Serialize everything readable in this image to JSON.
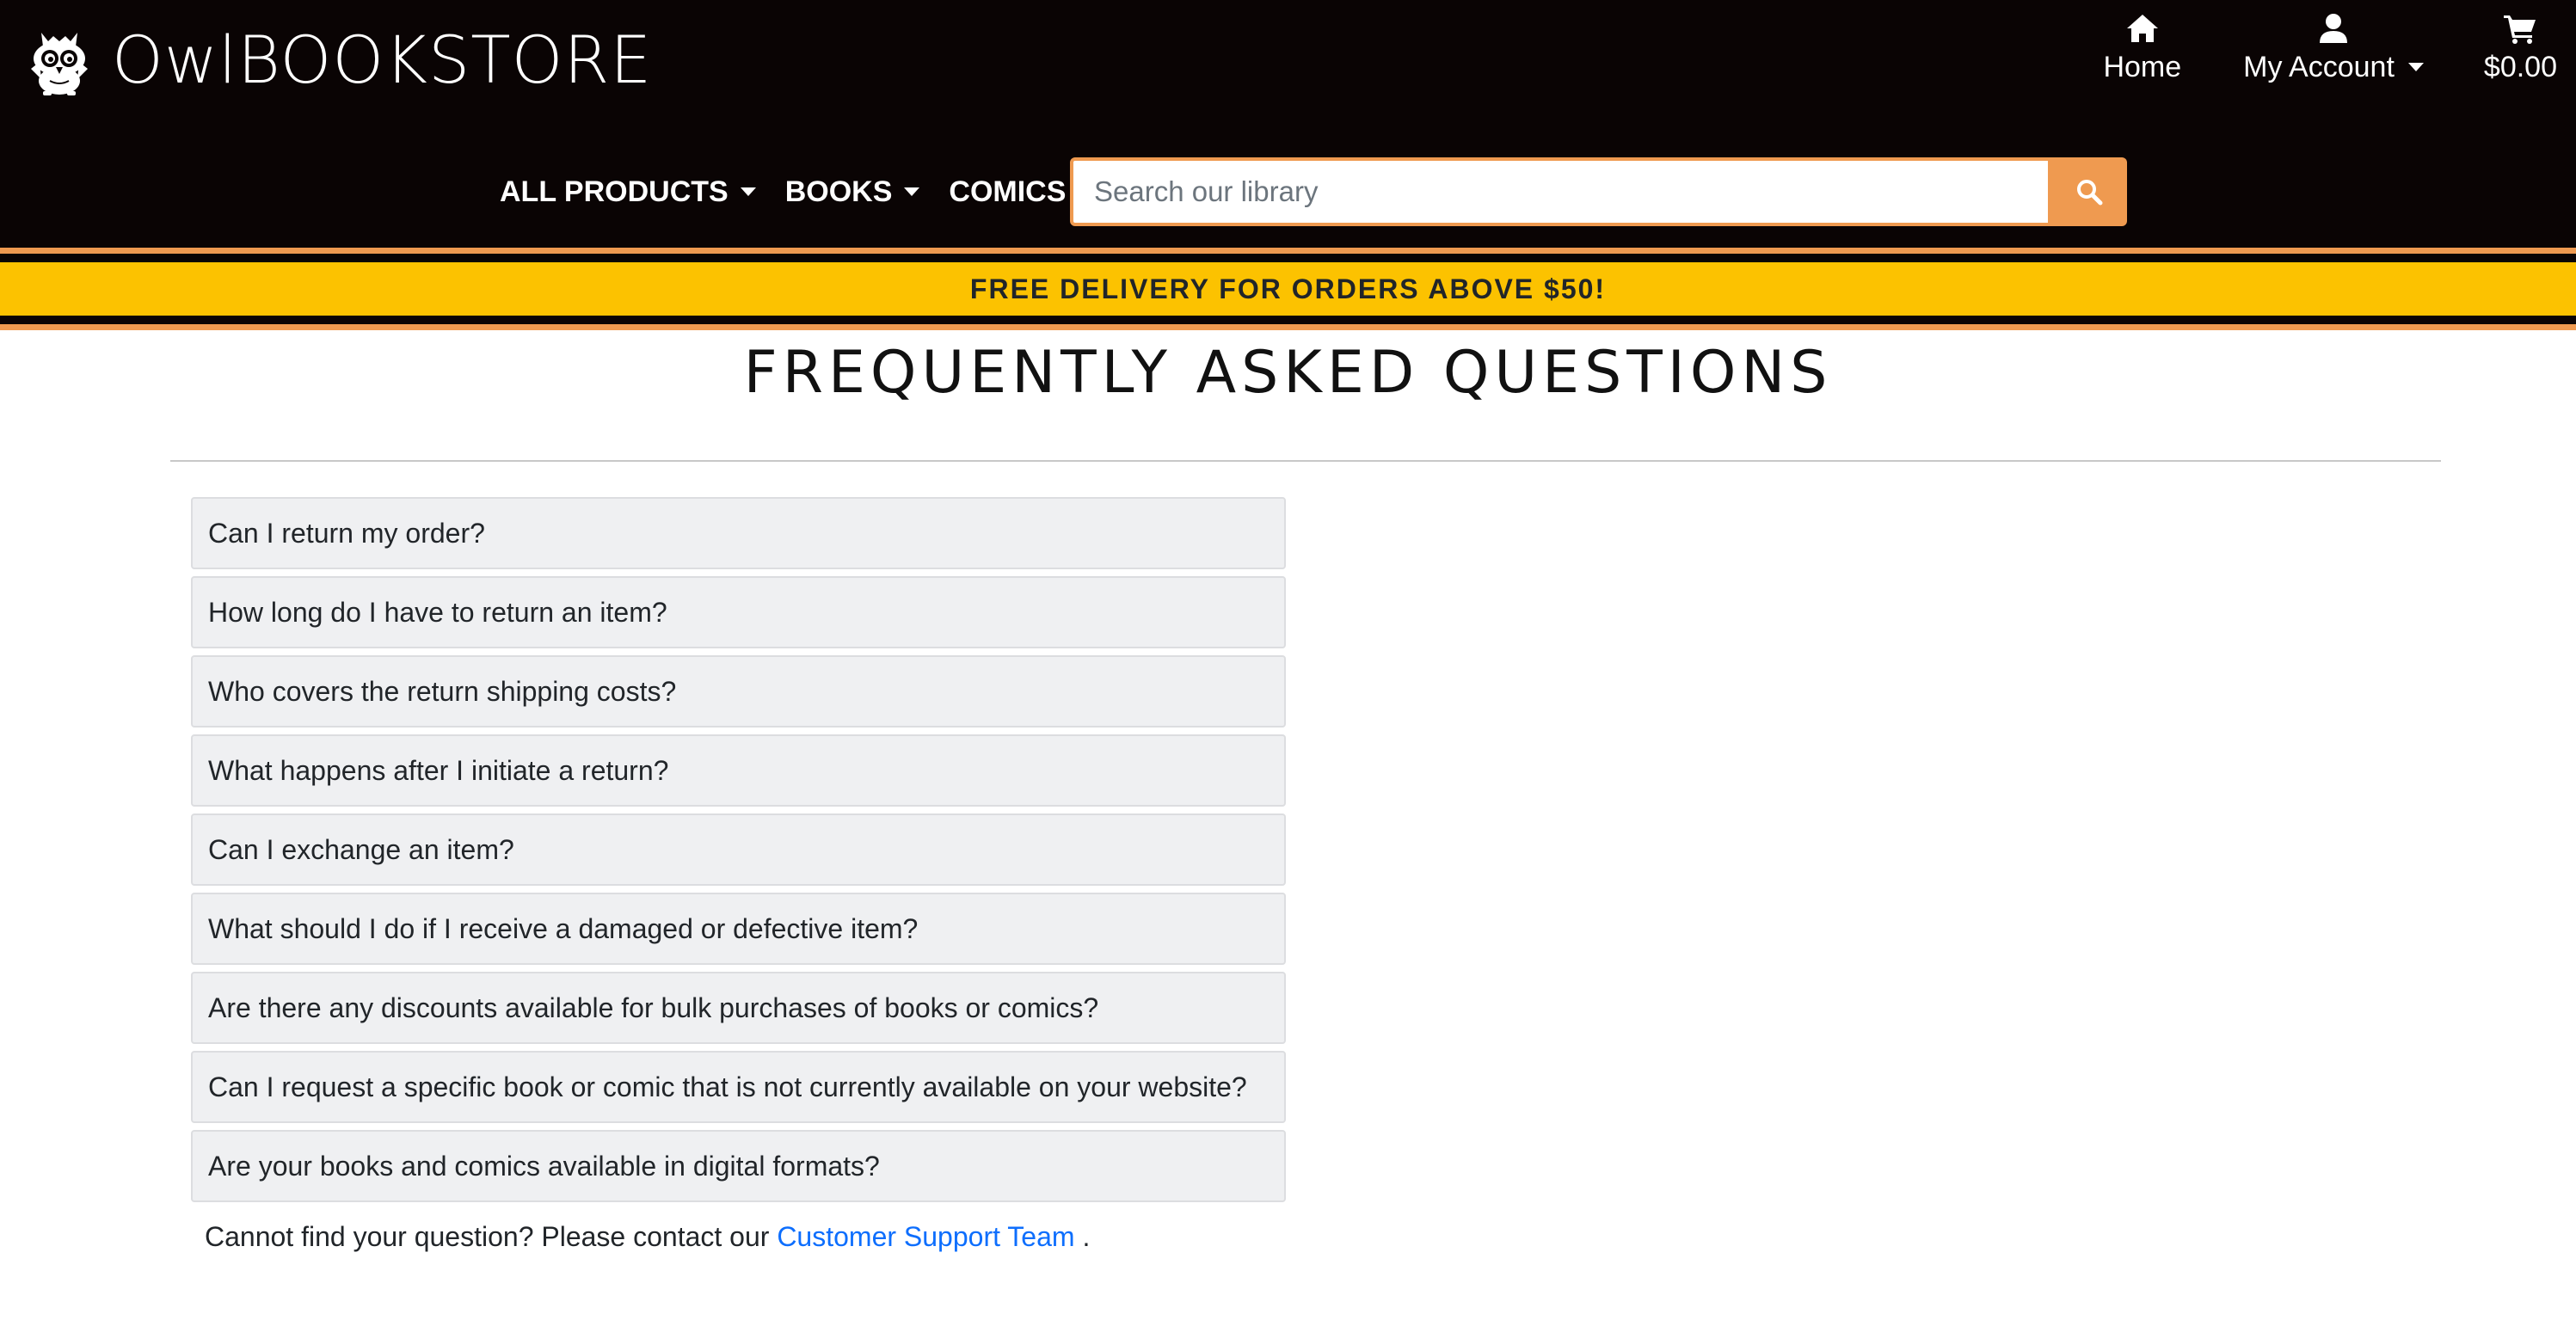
{
  "brand": {
    "name_light": "Owl",
    "name_bold": "BOOKSTORE",
    "logo_icon": "owl-icon"
  },
  "topnav": {
    "home": {
      "label": "Home",
      "icon": "home-icon"
    },
    "account": {
      "label": "My Account",
      "icon": "user-icon"
    },
    "cart": {
      "label": "$0.00",
      "icon": "cart-icon"
    }
  },
  "categories": [
    {
      "label": "ALL PRODUCTS"
    },
    {
      "label": "BOOKS"
    },
    {
      "label": "COMICS"
    }
  ],
  "search": {
    "placeholder": "Search our library",
    "value": "",
    "icon": "search-icon"
  },
  "banner": {
    "text": "FREE DELIVERY FOR ORDERS ABOVE $50!"
  },
  "page": {
    "title": "FREQUENTLY ASKED QUESTIONS"
  },
  "faq": [
    {
      "question": "Can I return my order?"
    },
    {
      "question": "How long do I have to return an item?"
    },
    {
      "question": "Who covers the return shipping costs?"
    },
    {
      "question": "What happens after I initiate a return?"
    },
    {
      "question": "Can I exchange an item?"
    },
    {
      "question": "What should I do if I receive a damaged or defective item?"
    },
    {
      "question": "Are there any discounts available for bulk purchases of books or comics?"
    },
    {
      "question": "Can I request a specific book or comic that is not currently available on your website?"
    },
    {
      "question": "Are your books and comics available in digital formats?"
    }
  ],
  "contact": {
    "prefix": "Cannot find your question? Please contact our",
    "link": "Customer Support Team",
    "suffix": "."
  },
  "colors": {
    "header_bg": "#0a0404",
    "accent_orange": "#ef9a50",
    "banner_yellow": "#fcc200",
    "link_blue": "#0d6efd",
    "faq_bg": "#eff0f2"
  }
}
